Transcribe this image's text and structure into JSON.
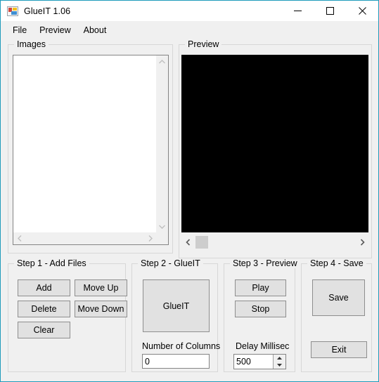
{
  "window": {
    "title": "GlueIT 1.06",
    "icon": "app-icon",
    "border_color": "#1f9bbb",
    "controls": {
      "minimize": "minimize",
      "maximize": "maximize",
      "close": "close"
    }
  },
  "menubar": {
    "items": [
      {
        "label": "File"
      },
      {
        "label": "Preview"
      },
      {
        "label": "About"
      }
    ]
  },
  "images_group": {
    "label": "Images",
    "listbox": {
      "items": [],
      "value": "",
      "vertical_scrollbar": {
        "up": "▲",
        "down": "▼"
      },
      "horizontal_scrollbar": {
        "left": "◀",
        "right": "▶"
      }
    }
  },
  "preview_group": {
    "label": "Preview",
    "canvas_color": "#000000",
    "scrollbar": {
      "left": "‹",
      "right": "›"
    }
  },
  "step1": {
    "label": "Step 1 - Add Files",
    "buttons": {
      "add": "Add",
      "move_up": "Move Up",
      "delete": "Delete",
      "move_down": "Move Down",
      "clear": "Clear"
    }
  },
  "step2": {
    "label": "Step 2 - GlueIT",
    "glueit_button": "GlueIT",
    "columns_label": "Number of Columns",
    "columns_value": "0"
  },
  "step3": {
    "label": "Step 3 - Preview",
    "buttons": {
      "play": "Play",
      "stop": "Stop"
    },
    "delay_label": "Delay Millisec",
    "delay_value": "500"
  },
  "step4": {
    "label": "Step 4 - Save",
    "buttons": {
      "save": "Save",
      "exit": "Exit"
    }
  }
}
